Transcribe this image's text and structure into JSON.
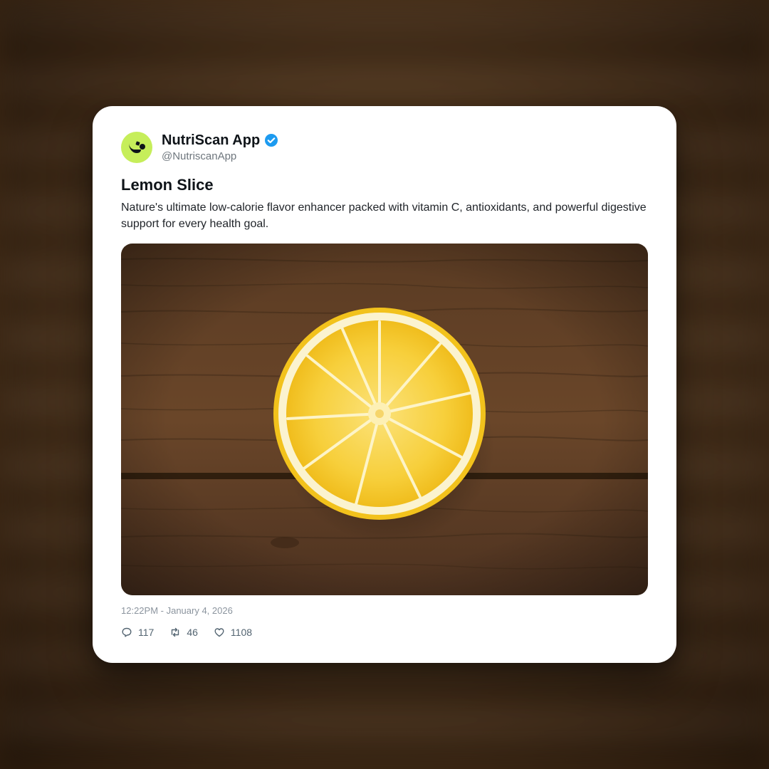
{
  "account": {
    "display_name": "NutriScan App",
    "handle": "@NutriscanApp",
    "verified": true,
    "avatar_icon": "nutriscan-logo-icon",
    "verified_icon": "verified-badge-icon"
  },
  "post": {
    "title": "Lemon Slice",
    "body": "Nature's ultimate low-calorie flavor enhancer packed with vitamin C, antioxidants, and powerful digestive support for every health goal.",
    "image_description": "Lemon slice on rustic wooden table",
    "timestamp": "12:22PM - January 4, 2026"
  },
  "stats": {
    "replies": "117",
    "retweets": "46",
    "likes": "1108"
  },
  "icons": {
    "reply": "reply-icon",
    "retweet": "retweet-icon",
    "like": "heart-icon"
  },
  "colors": {
    "avatar_bg": "#c6ee5a",
    "verified_blue": "#1d9bf0",
    "text_primary": "#0f1419",
    "text_secondary": "#6e767d",
    "lemon": "#f5c518"
  }
}
